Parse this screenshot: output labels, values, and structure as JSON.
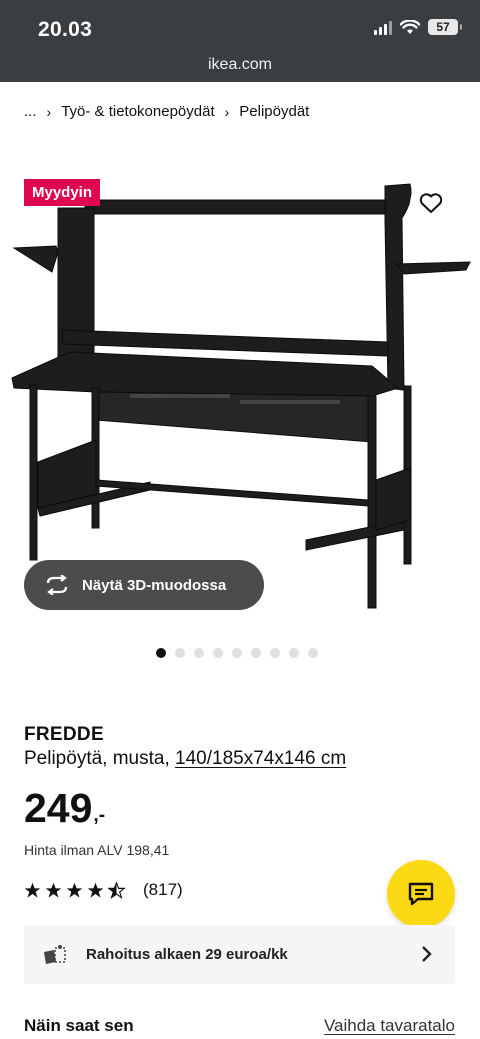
{
  "status_bar": {
    "time": "20.03",
    "battery": "57"
  },
  "browser": {
    "url": "ikea.com"
  },
  "breadcrumb": {
    "ellipsis": "...",
    "items": [
      "Työ- & tietokonepöydät",
      "Pelipöydät"
    ]
  },
  "product": {
    "badge": "Myydyin",
    "view_3d_label": "Näytä 3D-muodossa",
    "image_count": 9,
    "active_image": 1,
    "brand": "FREDDE",
    "description": "Pelipöytä, musta,",
    "measurements": "140/185x74x146 cm",
    "price_integer": "249",
    "price_decimal": ",-",
    "price_ex_vat": "Hinta ilman ALV 198,41",
    "rating": 4.5,
    "review_count": "(817)"
  },
  "financing": {
    "label": "Rahoitus alkaen 29 euroa/kk"
  },
  "delivery": {
    "title": "Näin saat sen",
    "change_store_label": "Vaihda tavaratalo"
  },
  "colors": {
    "badge": "#e00751",
    "chat_button": "#fbd914",
    "topbar": "#3b3e40"
  }
}
